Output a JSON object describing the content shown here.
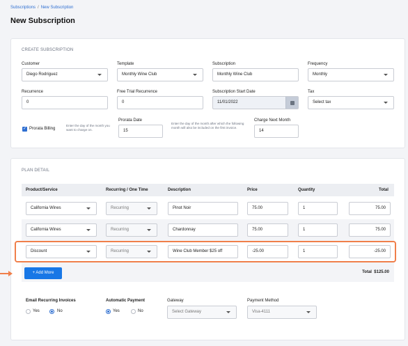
{
  "breadcrumb": {
    "parent": "Subscriptions",
    "separator": "/",
    "current": "New Subscription"
  },
  "page_title": "New Subscription",
  "create": {
    "section_title": "CREATE SUBSCRIPTION",
    "customer": {
      "label": "Customer",
      "value": "Diego Rodriguez"
    },
    "template": {
      "label": "Template",
      "value": "Monthly Wine Club"
    },
    "subscription": {
      "label": "Subscription",
      "value": "Monthly Wine Club"
    },
    "frequency": {
      "label": "Frequency",
      "value": "Monthly"
    },
    "recurrence": {
      "label": "Recurrence",
      "value": "0"
    },
    "free_trial": {
      "label": "Free Trial Recurrence",
      "value": "0"
    },
    "start_date": {
      "label": "Subscription Start Date",
      "value": "11/01/2022"
    },
    "tax": {
      "label": "Tax",
      "value": "Select tax"
    },
    "prorata": {
      "label": "Prorata Billing",
      "checked": true,
      "hint": "Enter the day of the month you want to charge on."
    },
    "prorata_date": {
      "label": "Prorata Date",
      "value": "15"
    },
    "next_hint": "Enter the day of the month after which the following month will also be included on the first invoice.",
    "charge_next": {
      "label": "Charge Next Month",
      "value": "14"
    }
  },
  "plan": {
    "section_title": "PLAN DETAIL",
    "columns": [
      "Product/Service",
      "Recurring / One Time",
      "Description",
      "Price",
      "Quantity",
      "Total"
    ],
    "rows": [
      {
        "product": "California Wines",
        "recurring": "Recurring",
        "description": "Pinot Noir",
        "price": "75.00",
        "quantity": "1",
        "total": "75.00"
      },
      {
        "product": "California Wines",
        "recurring": "Recurring",
        "description": "Chardonnay",
        "price": "75.00",
        "quantity": "1",
        "total": "75.00"
      },
      {
        "product": "Discount",
        "recurring": "Recurring",
        "description": "Wine Club Member $25 off",
        "price": "-25.00",
        "quantity": "1",
        "total": "-25.00"
      }
    ],
    "add_more": "+ Add More",
    "total_label": "Total",
    "total_value": "$125.00"
  },
  "billing": {
    "email_label": "Email Recurring Invoices",
    "email_options": [
      "Yes",
      "No"
    ],
    "email_selected": "No",
    "auto_label": "Automatic Payment",
    "auto_options": [
      "Yes",
      "No"
    ],
    "auto_selected": "Yes",
    "gateway": {
      "label": "Gateway",
      "placeholder": "Select Gateway"
    },
    "payment": {
      "label": "Payment Method",
      "value": "Visa-4111"
    }
  },
  "colors": {
    "accent": "#1877e6",
    "highlight": "#f07f4a"
  }
}
